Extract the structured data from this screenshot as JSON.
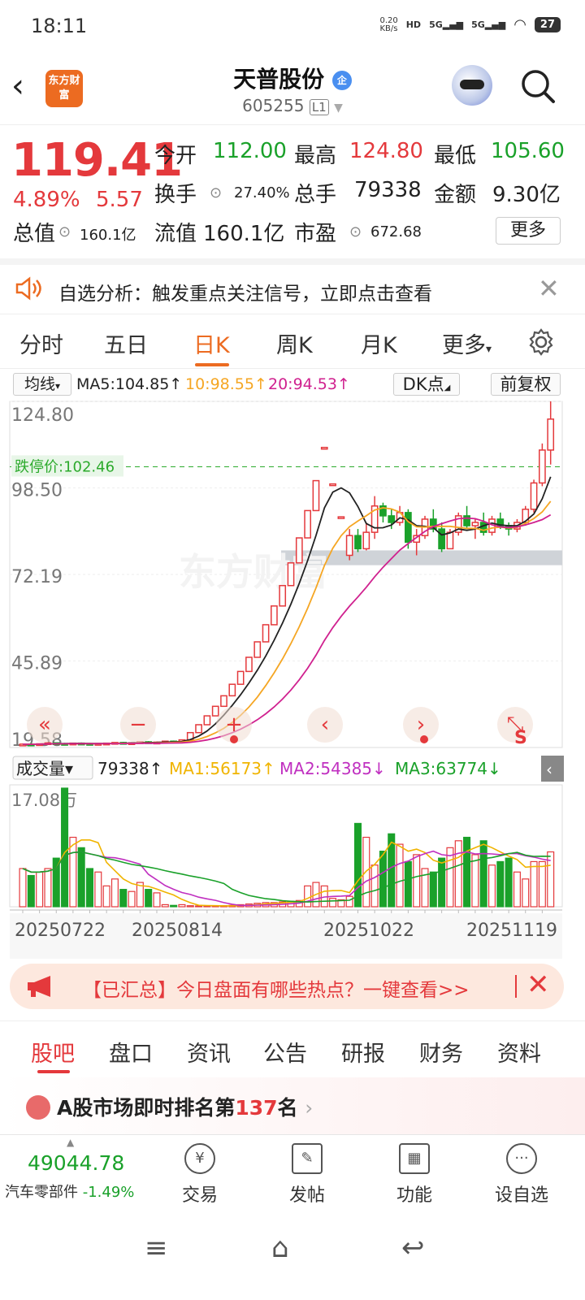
{
  "status": {
    "time": "18:11",
    "net_speed": "0.20\nKB/s",
    "battery": "27"
  },
  "header": {
    "logo": "东方财富",
    "name": "天普股份",
    "name_badge": "企",
    "code": "605255",
    "level": "L1"
  },
  "quote": {
    "price": "119.41",
    "change_pct": "4.89%",
    "change": "5.57",
    "open_label": "今开",
    "open": "112.00",
    "high_label": "最高",
    "high": "124.80",
    "low_label": "最低",
    "low": "105.60",
    "turnover_label": "换手",
    "turnover": "27.40%",
    "volume_label": "总手",
    "volume": "79338",
    "amount_label": "金额",
    "amount": "9.30亿",
    "mktcap_label": "总值",
    "mktcap": "160.1亿",
    "float_label": "流值",
    "float": "160.1亿",
    "pe_label": "市盈",
    "pe": "672.68",
    "more_label": "更多"
  },
  "banner": {
    "text": "自选分析：触发重点关注信号，立即点击查看"
  },
  "tabs": [
    "分时",
    "五日",
    "日K",
    "周K",
    "月K",
    "更多"
  ],
  "indicator": {
    "type": "均线",
    "ma5": "MA5:104.85↑",
    "ma10": "10:98.55↑",
    "ma20": "20:94.53↑",
    "dk": "DK点",
    "fq": "前复权"
  },
  "vol_indicator": {
    "type": "成交量",
    "vol": "79338↑",
    "ma1": "MA1:56173↑",
    "ma2": "MA2:54385↓",
    "ma3": "MA3:63774↓"
  },
  "chart_data": {
    "type": "candlestick",
    "y_ticks": [
      "124.80",
      "98.50",
      "72.19",
      "45.89",
      "19.58"
    ],
    "limit_label": "跌停价:102.46",
    "vol_max_label": "17.08万",
    "x_labels": [
      "20250722",
      "20250814",
      "20251022",
      "20251119"
    ],
    "candles": [
      [
        20.5,
        20.8,
        20.2,
        20.6
      ],
      [
        20.6,
        20.9,
        20.3,
        20.5
      ],
      [
        20.5,
        20.8,
        20.3,
        20.7
      ],
      [
        20.7,
        21.2,
        20.5,
        21.0
      ],
      [
        21.0,
        21.1,
        20.6,
        20.8
      ],
      [
        20.8,
        21.0,
        20.5,
        20.7
      ],
      [
        20.7,
        21.0,
        20.5,
        20.9
      ],
      [
        20.9,
        21.1,
        20.6,
        20.8
      ],
      [
        20.8,
        21.0,
        20.5,
        20.6
      ],
      [
        20.6,
        20.9,
        20.4,
        20.8
      ],
      [
        20.8,
        21.0,
        20.6,
        20.9
      ],
      [
        20.9,
        21.2,
        20.7,
        21.1
      ],
      [
        21.1,
        21.3,
        20.8,
        20.9
      ],
      [
        20.9,
        21.2,
        20.7,
        21.0
      ],
      [
        21.0,
        21.4,
        20.8,
        21.3
      ],
      [
        21.3,
        21.5,
        21.0,
        21.1
      ],
      [
        21.1,
        21.4,
        20.9,
        21.2
      ],
      [
        21.2,
        21.6,
        21.0,
        21.5
      ],
      [
        21.5,
        21.7,
        21.2,
        21.3
      ],
      [
        21.3,
        22.0,
        21.2,
        21.9
      ],
      [
        21.9,
        24.1,
        21.9,
        24.1
      ],
      [
        24.1,
        26.5,
        24.1,
        26.5
      ],
      [
        26.5,
        29.2,
        26.5,
        29.2
      ],
      [
        29.2,
        32.1,
        29.2,
        32.1
      ],
      [
        32.1,
        35.3,
        32.1,
        35.3
      ],
      [
        35.3,
        38.8,
        35.3,
        38.8
      ],
      [
        38.8,
        42.7,
        38.8,
        42.7
      ],
      [
        42.7,
        47.0,
        42.7,
        47.0
      ],
      [
        47.0,
        51.7,
        47.0,
        51.7
      ],
      [
        51.7,
        56.9,
        51.7,
        56.9
      ],
      [
        56.9,
        62.6,
        56.9,
        62.6
      ],
      [
        62.6,
        68.8,
        62.6,
        68.8
      ],
      [
        68.8,
        75.7,
        68.8,
        75.7
      ],
      [
        75.7,
        83.3,
        75.7,
        83.3
      ],
      [
        83.3,
        91.6,
        83.3,
        91.6
      ],
      [
        91.6,
        100.7,
        91.6,
        100.7
      ],
      [
        110.8,
        110.8,
        110.8,
        110.8
      ],
      [
        99.7,
        99.7,
        99.7,
        99.7
      ],
      [
        89.7,
        89.7,
        89.7,
        89.7
      ],
      [
        78.0,
        86.0,
        76.5,
        84.0
      ],
      [
        84.0,
        86.0,
        79.0,
        80.0
      ],
      [
        80.0,
        88.0,
        79.5,
        85.0
      ],
      [
        85.0,
        96.0,
        83.0,
        93.0
      ],
      [
        93.0,
        94.0,
        88.0,
        90.0
      ],
      [
        90.0,
        92.0,
        86.0,
        88.0
      ],
      [
        88.0,
        93.0,
        87.0,
        91.0
      ],
      [
        91.0,
        92.0,
        80.0,
        82.0
      ],
      [
        82.0,
        86.0,
        78.0,
        84.0
      ],
      [
        84.0,
        90.0,
        83.0,
        89.0
      ],
      [
        89.0,
        92.0,
        85.0,
        86.0
      ],
      [
        86.0,
        88.0,
        79.0,
        80.0
      ],
      [
        80.0,
        86.0,
        80.0,
        85.0
      ],
      [
        85.0,
        91.0,
        84.0,
        90.0
      ],
      [
        90.0,
        93.0,
        86.0,
        87.0
      ],
      [
        87.0,
        89.0,
        83.0,
        88.0
      ],
      [
        88.0,
        91.0,
        84.0,
        85.0
      ],
      [
        85.0,
        90.0,
        84.0,
        89.0
      ],
      [
        89.0,
        91.0,
        86.0,
        87.0
      ],
      [
        87.0,
        88.0,
        84.0,
        86.0
      ],
      [
        86.0,
        89.0,
        85.0,
        88.0
      ],
      [
        88.0,
        93.0,
        87.0,
        92.0
      ],
      [
        92.0,
        101.0,
        91.0,
        100.0
      ],
      [
        100.0,
        112.0,
        99.0,
        110.0
      ],
      [
        110.0,
        124.8,
        105.6,
        119.41
      ]
    ],
    "volumes": [
      5.5,
      4.5,
      5.0,
      5.5,
      7.0,
      17.08,
      10.0,
      8.5,
      5.5,
      5.0,
      3.0,
      4.0,
      2.5,
      2.2,
      3.5,
      2.5,
      2.0,
      0.3,
      0.2,
      0.3,
      0.15,
      0.12,
      0.1,
      0.1,
      0.15,
      0.2,
      0.3,
      0.4,
      0.5,
      0.6,
      0.6,
      0.7,
      0.8,
      0.9,
      3.0,
      3.5,
      3.0,
      1.2,
      1.0,
      1.5,
      12.0,
      10.0,
      6.0,
      8.0,
      10.5,
      9.0,
      6.5,
      7.5,
      5.5,
      5.0,
      7.0,
      8.5,
      9.5,
      10.0,
      7.5,
      9.5,
      6.0,
      6.5,
      7.0,
      5.0,
      4.0,
      6.5,
      6.5,
      7.9
    ],
    "ma_lines": [
      {
        "name": "MA5",
        "color": "#222222"
      },
      {
        "name": "MA10",
        "color": "#f5a623"
      },
      {
        "name": "MA20",
        "color": "#d0218f"
      }
    ]
  },
  "news": {
    "text": "【已汇总】今日盘面有哪些热点？一键查看>>"
  },
  "bottom_tabs": [
    "股吧",
    "盘口",
    "资讯",
    "公告",
    "研报",
    "财务",
    "资料"
  ],
  "rank": {
    "prefix": "A股市场即时排名第",
    "num": "137",
    "suffix": "名"
  },
  "bottom_bar": {
    "index_value": "49044.78",
    "index_name": "汽车零部件",
    "index_change": "-1.49%",
    "trade": "交易",
    "post": "发帖",
    "func": "功能",
    "watch": "设自选"
  }
}
